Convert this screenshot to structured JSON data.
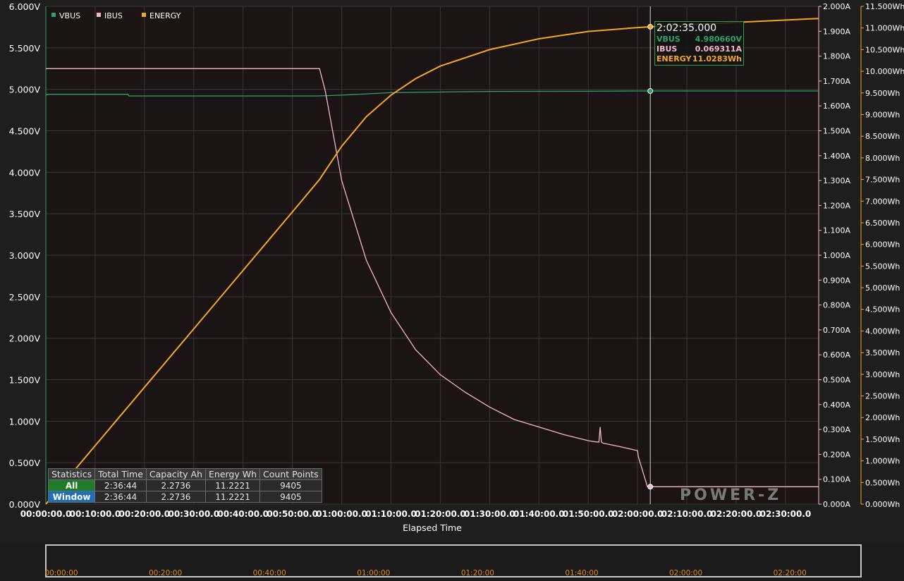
{
  "header": {
    "title": ""
  },
  "legend": [
    {
      "name": "VBUS",
      "color": "#2ea36b"
    },
    {
      "name": "IBUS",
      "color": "#f4b6c8"
    },
    {
      "name": "ENERGY",
      "color": "#f5a623"
    }
  ],
  "chart_data": {
    "type": "line",
    "xlabel": "Elapsed Time",
    "x_range_seconds": [
      0,
      9404
    ],
    "x_ticks": [
      "00:00:00.0",
      "00:10:00.0",
      "00:20:00.0",
      "00:30:00.0",
      "00:40:00.0",
      "00:50:00.0",
      "01:00:00.0",
      "01:10:00.0",
      "01:20:00.0",
      "01:30:00.0",
      "01:40:00.0",
      "01:50:00.0",
      "02:00:00.0",
      "02:10:00.0",
      "02:20:00.0",
      "02:30:00.0"
    ],
    "y_left": {
      "label": "VBUS",
      "unit": "V",
      "range": [
        0,
        6
      ],
      "ticks": [
        "0.000V",
        "0.500V",
        "1.000V",
        "1.500V",
        "2.000V",
        "2.500V",
        "3.000V",
        "3.500V",
        "4.000V",
        "4.500V",
        "5.000V",
        "5.500V",
        "6.000V"
      ]
    },
    "y_right1": {
      "label": "IBUS",
      "unit": "A",
      "range": [
        0,
        2
      ],
      "ticks": [
        "0.000A",
        "0.100A",
        "0.200A",
        "0.300A",
        "0.400A",
        "0.500A",
        "0.600A",
        "0.700A",
        "0.800A",
        "0.900A",
        "1.000A",
        "1.100A",
        "1.200A",
        "1.300A",
        "1.400A",
        "1.500A",
        "1.600A",
        "1.700A",
        "1.800A",
        "1.900A",
        "2.000A"
      ]
    },
    "y_right2": {
      "label": "ENERGY",
      "unit": "Wh",
      "range": [
        0,
        11.5
      ],
      "ticks": [
        "0.000Wh",
        "0.500Wh",
        "1.000Wh",
        "1.500Wh",
        "2.000Wh",
        "2.500Wh",
        "3.000Wh",
        "3.500Wh",
        "4.000Wh",
        "4.500Wh",
        "5.000Wh",
        "5.500Wh",
        "6.000Wh",
        "6.500Wh",
        "7.000Wh",
        "7.500Wh",
        "8.000Wh",
        "8.500Wh",
        "9.000Wh",
        "9.500Wh",
        "10.000Wh",
        "10.500Wh",
        "11.000Wh",
        "11.500Wh"
      ]
    },
    "grid": true,
    "legend_position": "top-left",
    "series": [
      {
        "name": "VBUS",
        "axis": "left",
        "color": "#2ea36b",
        "x": [
          0,
          30,
          60,
          600,
          1000,
          1010,
          1030,
          1800,
          2400,
          3300,
          3600,
          4200,
          5400,
          6600,
          7200,
          7500,
          9404
        ],
        "y": [
          4.93,
          4.94,
          4.94,
          4.94,
          4.94,
          4.92,
          4.92,
          4.92,
          4.92,
          4.92,
          4.93,
          4.96,
          4.975,
          4.977,
          4.98,
          4.98,
          4.98
        ]
      },
      {
        "name": "IBUS",
        "axis": "right1",
        "color": "#f4b6c8",
        "x": [
          0,
          3330,
          3400,
          3600,
          3900,
          4200,
          4500,
          4800,
          5100,
          5400,
          5700,
          6000,
          6300,
          6600,
          6700,
          6730,
          6745,
          6760,
          6780,
          7000,
          7200,
          7210,
          7320,
          7350,
          9404
        ],
        "y": [
          1.75,
          1.75,
          1.66,
          1.3,
          0.98,
          0.77,
          0.62,
          0.52,
          0.45,
          0.39,
          0.34,
          0.31,
          0.28,
          0.255,
          0.25,
          0.25,
          0.31,
          0.25,
          0.245,
          0.23,
          0.215,
          0.19,
          0.07,
          0.07,
          0.07
        ]
      },
      {
        "name": "ENERGY",
        "axis": "right2",
        "color": "#f5a623",
        "x": [
          0,
          600,
          1200,
          1800,
          2400,
          3000,
          3330,
          3600,
          3900,
          4200,
          4500,
          4800,
          5400,
          6000,
          6600,
          7200,
          7355,
          7800,
          8400,
          9404
        ],
        "y": [
          0,
          1.35,
          2.7,
          4.05,
          5.4,
          6.75,
          7.5,
          8.27,
          8.95,
          9.45,
          9.83,
          10.12,
          10.5,
          10.75,
          10.92,
          11.01,
          11.028,
          11.07,
          11.13,
          11.22
        ]
      }
    ],
    "cursor": {
      "x_seconds": 7355,
      "time": "2:02:35.000",
      "values": [
        {
          "name": "VBUS",
          "value": "4.980660V",
          "color": "#2ea36b"
        },
        {
          "name": "IBUS",
          "value": "0.069311A",
          "color": "#f4b6c8"
        },
        {
          "name": "ENERGY",
          "value": "11.0283Wh",
          "color": "#f5a623"
        }
      ]
    }
  },
  "navigator": {
    "ticks": [
      "00:00:00",
      "00:20:00",
      "00:40:00",
      "01:00:00",
      "01:20:00",
      "01:40:00",
      "02:00:00",
      "02:20:00"
    ],
    "tick_color": "#e0891b"
  },
  "statistics": {
    "headers": [
      "Statistics",
      "Total Time",
      "Capacity Ah",
      "Energy Wh",
      "Count Points"
    ],
    "rows": [
      {
        "label": "All",
        "total_time": "2:36:44",
        "capacity": "2.2736",
        "energy": "11.2221",
        "points": "9405"
      },
      {
        "label": "Window",
        "total_time": "2:36:44",
        "capacity": "2.2736",
        "energy": "11.2221",
        "points": "9405"
      }
    ]
  },
  "logo": {
    "text": "POWER-Z"
  }
}
